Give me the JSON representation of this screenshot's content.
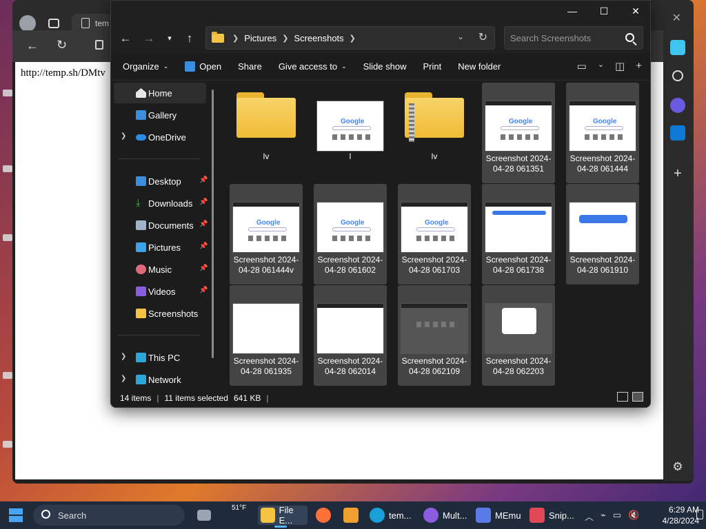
{
  "browser": {
    "tab_title": "tem",
    "page_text": "http://temp.sh/DMtv"
  },
  "explorer": {
    "window_controls": {
      "minimize": "—",
      "maximize": "☐",
      "close": "✕"
    },
    "breadcrumb": [
      "Pictures",
      "Screenshots"
    ],
    "search_placeholder": "Search Screenshots",
    "commands": {
      "organize": "Organize",
      "open": "Open",
      "share": "Share",
      "give_access": "Give access to",
      "slide_show": "Slide show",
      "print": "Print",
      "new_folder": "New folder"
    },
    "nav": {
      "home": "Home",
      "gallery": "Gallery",
      "onedrive": "OneDrive",
      "desktop": "Desktop",
      "downloads": "Downloads",
      "documents": "Documents",
      "pictures": "Pictures",
      "music": "Music",
      "videos": "Videos",
      "screenshots": "Screenshots",
      "this_pc": "This PC",
      "network": "Network"
    },
    "files": [
      {
        "name": "lv",
        "kind": "folder",
        "selected": false
      },
      {
        "name": "l",
        "kind": "image",
        "selected": false
      },
      {
        "name": "lv",
        "kind": "zip",
        "selected": false
      },
      {
        "name": "Screenshot 2024-04-28 061351",
        "kind": "image",
        "selected": true
      },
      {
        "name": "Screenshot 2024-04-28 061444",
        "kind": "image",
        "selected": true
      },
      {
        "name": "Screenshot 2024-04-28 061444v",
        "kind": "image",
        "selected": true
      },
      {
        "name": "Screenshot 2024-04-28 061602",
        "kind": "image",
        "selected": true
      },
      {
        "name": "Screenshot 2024-04-28 061703",
        "kind": "image",
        "selected": true
      },
      {
        "name": "Screenshot 2024-04-28 061738",
        "kind": "image",
        "selected": true
      },
      {
        "name": "Screenshot 2024-04-28 061910",
        "kind": "image",
        "selected": true
      },
      {
        "name": "Screenshot 2024-04-28 061935",
        "kind": "doc",
        "selected": true
      },
      {
        "name": "Screenshot 2024-04-28 062014",
        "kind": "doc",
        "selected": true
      },
      {
        "name": "Screenshot 2024-04-28 062109",
        "kind": "dark",
        "selected": true
      },
      {
        "name": "Screenshot 2024-04-28 062203",
        "kind": "dark",
        "selected": true
      }
    ],
    "status": {
      "items": "14 items",
      "selected": "11 items selected",
      "size": "641 KB"
    }
  },
  "taskbar": {
    "search": "Search",
    "weather": "51°F",
    "apps": [
      "File E...",
      "tem...",
      "Mult...",
      "MEmu",
      "Snip..."
    ],
    "time": "6:29 AM",
    "date": "4/28/2024"
  },
  "colors": {
    "accent": "#5cb3ff",
    "folder": "#f4c542",
    "selection": "#444444"
  }
}
